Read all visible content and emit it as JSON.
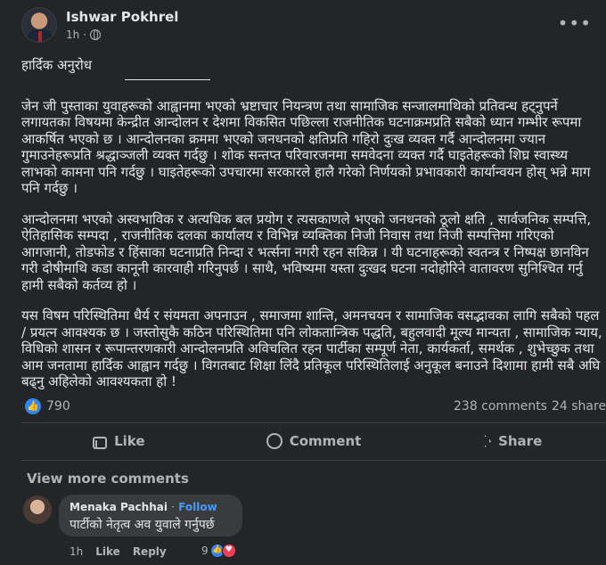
{
  "post": {
    "author": "Ishwar Pokhrel",
    "time": "1h",
    "time_separator": "·",
    "title": "हार्दिक अनुरोध",
    "paragraphs": [
      "जेन जी पुस्ताका युवाहरूको आह्वानमा भएको  भ्रष्टाचार नियन्त्रण तथा सामाजिक सन्जालमाथिको प्रतिवन्ध हट्नुपर्ने लगायतका विषयमा केन्द्रीत आन्दोलन र देशमा विकसित पछिल्ला राजनीतिक घटनाक्रमप्रति  सबैको ध्यान गम्भीर रूपमा आकर्षित भएको छ । आन्दोलनका क्रममा भएको जनधनको क्षतिप्रति गहिरो दुःख व्यक्त गर्दै आन्दोलनमा ज्यान गुमाउनेहरूप्रति श्रद्धाञ्जली व्यक्त गर्दछु । शोक सन्तप्त परिवारजनमा समवेदना व्यक्त गर्दै घाइतेहरूको शिघ्र स्वास्थ्य लाभको कामना पनि गर्दछु । घाइतेहरूको उपचारमा सरकारले  हालै गरेको निर्णयको प्रभावकारी कार्यान्वयन होस् भन्ने माग पनि गर्दछु ।",
      "आन्दोलनमा भएको अस्वभाविक र अत्यधिक बल प्रयोग र त्यसकाणले भएको जनधनको ठूलो क्षति , सार्वजनिक सम्पत्ति, ऐतिहासिक सम्पदा , राजनीतिक दलका कार्यालय र विभिन्न व्यक्तिका निजी निवास तथा निजी सम्पत्तिमा गरिएको आगजानी, तोडफोड र हिंसाका घटनाप्रति निन्दा र भर्त्सना नगरी रहन सकिन्न । यी घटनाहरूको स्वतन्त्र र निष्पक्ष छानविन गरी दोषीमाथि कडा कानूनी कारवाही गरिनुपर्छ । साथै, भविष्यमा यस्ता दुःखद घटना नदोहोरिने वातावरण सुनिश्चित गर्नु हामी सबैको कर्तव्य हो ।",
      "यस विषम परिस्थितिमा धैर्य र संयमता अपनाउन , समाजमा शान्ति, अमनचयन र सामाजिक वसद्भावका लागि सबैको पहल / प्रयत्न आवश्यक  छ । जस्तोसुकै कठिन परिस्थितिमा पनि लोकतान्त्रिक पद्धति, बहुलवादी मूल्य मान्यता , सामाजिक न्याय, विधिको शासन र रूपान्तरणकारी आन्दोलनप्रति अविचलित रहन पार्टीका सम्पूर्ण नेता, कार्यकर्ता, समर्थक , शुभेच्छुक तथा आम जनतामा हार्दिक आह्वान गर्दछु । विगतबाट शिक्षा लिंदै प्रतिकूल परिस्थितिलाई अनुकूल बनाउने दिशामा हामी सबै अघि बढ्नु अहिलेको आवश्यकता हो !"
    ]
  },
  "stats": {
    "reactions": "790",
    "comments": "238 comments",
    "shares": "24 shares"
  },
  "actions": {
    "like": "Like",
    "comment": "Comment",
    "share": "Share"
  },
  "comments": {
    "view_more": "View more comments",
    "items": [
      {
        "author": "Menaka Pachhai",
        "separator": "·",
        "follow": "Follow",
        "text": "पार्टीको नेतृत्व अव युवाले गर्नुपर्छ",
        "time": "1h",
        "like": "Like",
        "reply": "Reply",
        "reaction_count": "9"
      }
    ]
  },
  "colors": {
    "background": "#242526",
    "text": "#e4e6eb",
    "muted": "#b0b3b8",
    "accent": "#2d88ff",
    "link": "#4599ff"
  }
}
